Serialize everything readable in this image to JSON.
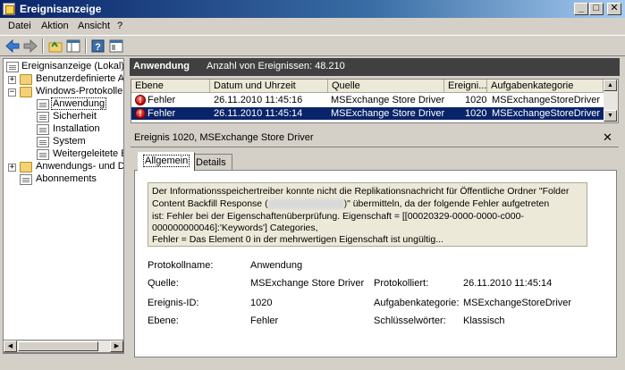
{
  "window": {
    "title": "Ereignisanzeige",
    "buttons": {
      "min": "_",
      "max": "□",
      "close": "✕"
    }
  },
  "menu": [
    "Datei",
    "Aktion",
    "Ansicht",
    "?"
  ],
  "tree": {
    "root": "Ereignisanzeige (Lokal)",
    "custom_views": "Benutzerdefinierte Ans",
    "windows_logs": "Windows-Protokolle",
    "logs": [
      "Anwendung",
      "Sicherheit",
      "Installation",
      "System",
      "Weitergeleitete Ere"
    ],
    "app_logs": "Anwendungs- und Dien",
    "subscriptions": "Abonnements"
  },
  "header": {
    "title": "Anwendung",
    "count": "Anzahl von Ereignissen: 48.210"
  },
  "grid": {
    "columns": [
      "Ebene",
      "Datum und Uhrzeit",
      "Quelle",
      "Ereigni...",
      "Aufgabenkategorie"
    ],
    "rows": [
      {
        "level": "Fehler",
        "date": "26.11.2010 11:45:16",
        "source": "MSExchange Store Driver",
        "id": "1020",
        "category": "MSExchangeStoreDriver",
        "selected": false
      },
      {
        "level": "Fehler",
        "date": "26.11.2010 11:45:14",
        "source": "MSExchange Store Driver",
        "id": "1020",
        "category": "MSExchangeStoreDriver",
        "selected": true
      }
    ]
  },
  "detail": {
    "title": "Ereignis 1020, MSExchange Store Driver",
    "close": "✕",
    "tabs": [
      "Allgemein",
      "Details"
    ],
    "message": {
      "line1": "Der Informationsspeichertreiber konnte nicht die Replikationsnachricht für Öffentliche Ordner \"Folder",
      "line2a": "Content Backfill Response (",
      "line2b": ")\" übermitteln, da der folgende Fehler aufgetreten",
      "line3": "ist: Fehler bei der Eigenschaftenüberprüfung. Eigenschaft = [[00020329-0000-0000-c000-",
      "line4": "000000000046]:'Keywords'] Categories,",
      "line5": "Fehler = Das Element 0 in der mehrwertigen Eigenschaft ist ungültig..."
    },
    "fields": {
      "log_name_label": "Protokollname:",
      "log_name": "Anwendung",
      "source_label": "Quelle:",
      "source": "MSExchange Store Driver",
      "logged_label": "Protokolliert:",
      "logged": "26.11.2010 11:45:14",
      "event_id_label": "Ereignis-ID:",
      "event_id": "1020",
      "task_label": "Aufgabenkategorie:",
      "task": "MSExchangeStoreDriver",
      "level_label": "Ebene:",
      "level": "Fehler",
      "keywords_label": "Schlüsselwörter:",
      "keywords": "Klassisch"
    }
  },
  "colors": {
    "header_bg": "#404040",
    "selection": "#0a246a",
    "titlebar": "#0a246a"
  }
}
